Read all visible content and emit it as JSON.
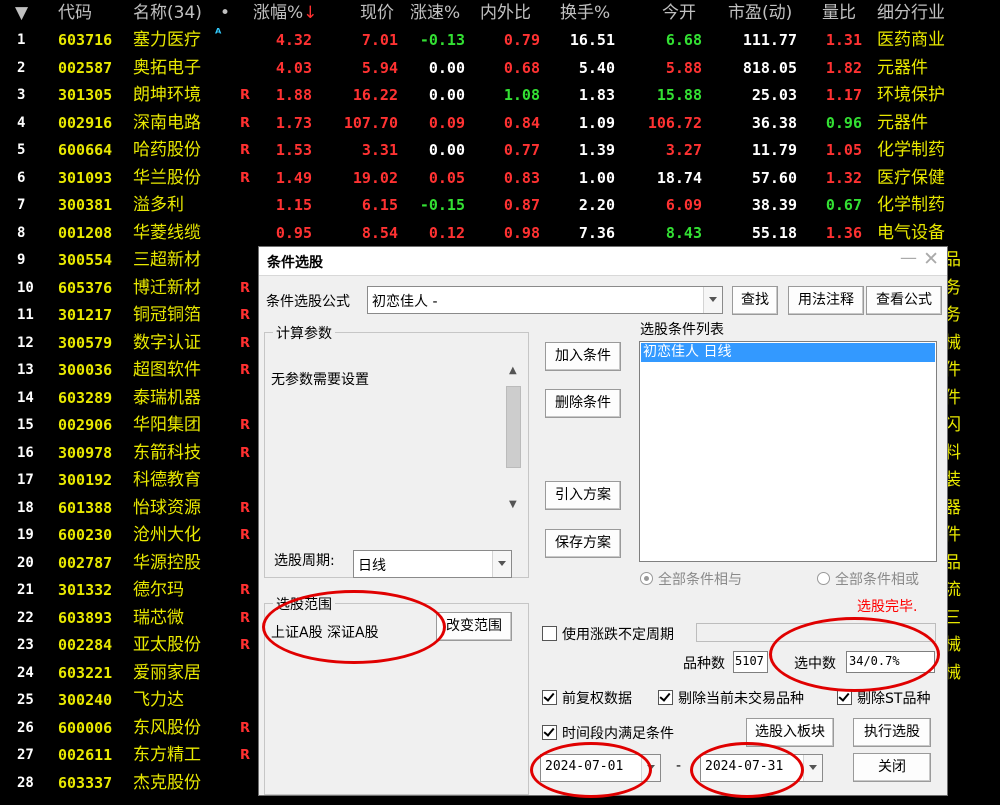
{
  "table": {
    "headers": {
      "sort": "▼",
      "code": "代码",
      "name": "名称(34)",
      "dot": "•",
      "pct": "涨幅%",
      "pct_mark": "↓",
      "price": "现价",
      "speed": "涨速%",
      "io": "内外比",
      "turnover": "换手%",
      "open": "今开",
      "pe": "市盈(动)",
      "vr": "量比",
      "industry": "细分行业"
    },
    "rows": [
      {
        "idx": "1",
        "code": "603716",
        "name": "塞力医疗",
        "flag": "ᴬ",
        "pct": "4.32",
        "price": "7.01",
        "speed": "-0.13",
        "io": "0.79",
        "turnover": "16.51",
        "open": "6.68",
        "pe": "111.77",
        "vr": "1.31",
        "industry": "医药商业"
      },
      {
        "idx": "2",
        "code": "002587",
        "name": "奥拓电子",
        "flag": "",
        "pct": "4.03",
        "price": "5.94",
        "speed": "0.00",
        "io": "0.68",
        "turnover": "5.40",
        "open": "5.88",
        "pe": "818.05",
        "vr": "1.82",
        "industry": "元器件"
      },
      {
        "idx": "3",
        "code": "301305",
        "name": "朗坤环境",
        "flag": "R",
        "pct": "1.88",
        "price": "16.22",
        "speed": "0.00",
        "io": "1.08",
        "turnover": "1.83",
        "open": "15.88",
        "pe": "25.03",
        "vr": "1.17",
        "industry": "环境保护"
      },
      {
        "idx": "4",
        "code": "002916",
        "name": "深南电路",
        "flag": "R",
        "pct": "1.73",
        "price": "107.70",
        "speed": "0.09",
        "io": "0.84",
        "turnover": "1.09",
        "open": "106.72",
        "pe": "36.38",
        "vr": "0.96",
        "industry": "元器件"
      },
      {
        "idx": "5",
        "code": "600664",
        "name": "哈药股份",
        "flag": "R",
        "pct": "1.53",
        "price": "3.31",
        "speed": "0.00",
        "io": "0.77",
        "turnover": "1.39",
        "open": "3.27",
        "pe": "11.79",
        "vr": "1.05",
        "industry": "化学制药"
      },
      {
        "idx": "6",
        "code": "301093",
        "name": "华兰股份",
        "flag": "R",
        "pct": "1.49",
        "price": "19.02",
        "speed": "0.05",
        "io": "0.83",
        "turnover": "1.00",
        "open": "18.74",
        "pe": "57.60",
        "vr": "1.32",
        "industry": "医疗保健"
      },
      {
        "idx": "7",
        "code": "300381",
        "name": "溢多利",
        "flag": "",
        "pct": "1.15",
        "price": "6.15",
        "speed": "-0.15",
        "io": "0.87",
        "turnover": "2.20",
        "open": "6.09",
        "pe": "38.39",
        "vr": "0.67",
        "industry": "化学制药"
      },
      {
        "idx": "8",
        "code": "001208",
        "name": "华菱线缆",
        "flag": "",
        "pct": "0.95",
        "price": "8.54",
        "speed": "0.12",
        "io": "0.98",
        "turnover": "7.36",
        "open": "8.43",
        "pe": "55.18",
        "vr": "1.36",
        "industry": "电气设备"
      },
      {
        "idx": "9",
        "code": "300554",
        "name": "三超新材",
        "flag": ""
      },
      {
        "idx": "10",
        "code": "605376",
        "name": "博迁新材",
        "flag": "R"
      },
      {
        "idx": "11",
        "code": "301217",
        "name": "铜冠铜箔",
        "flag": "R"
      },
      {
        "idx": "12",
        "code": "300579",
        "name": "数字认证",
        "flag": "R"
      },
      {
        "idx": "13",
        "code": "300036",
        "name": "超图软件",
        "flag": "R"
      },
      {
        "idx": "14",
        "code": "603289",
        "name": "泰瑞机器",
        "flag": ""
      },
      {
        "idx": "15",
        "code": "002906",
        "name": "华阳集团",
        "flag": "R"
      },
      {
        "idx": "16",
        "code": "300978",
        "name": "东箭科技",
        "flag": "R"
      },
      {
        "idx": "17",
        "code": "300192",
        "name": "科德教育",
        "flag": ""
      },
      {
        "idx": "18",
        "code": "601388",
        "name": "怡球资源",
        "flag": "R"
      },
      {
        "idx": "19",
        "code": "600230",
        "name": "沧州大化",
        "flag": "R"
      },
      {
        "idx": "20",
        "code": "002787",
        "name": "华源控股",
        "flag": ""
      },
      {
        "idx": "21",
        "code": "301332",
        "name": "德尔玛",
        "flag": "R"
      },
      {
        "idx": "22",
        "code": "603893",
        "name": "瑞芯微",
        "flag": "R"
      },
      {
        "idx": "23",
        "code": "002284",
        "name": "亚太股份",
        "flag": "R"
      },
      {
        "idx": "24",
        "code": "603221",
        "name": "爱丽家居",
        "flag": ""
      },
      {
        "idx": "25",
        "code": "300240",
        "name": "飞力达",
        "flag": ""
      },
      {
        "idx": "26",
        "code": "600006",
        "name": "东风股份",
        "flag": "R"
      },
      {
        "idx": "27",
        "code": "002611",
        "name": "东方精工",
        "flag": "R"
      },
      {
        "idx": "28",
        "code": "603337",
        "name": "杰克股份",
        "flag": ""
      }
    ],
    "colors": {
      "up": "#ff3232",
      "down": "#33e033",
      "flat": "#ffffff",
      "name": "#e8e800"
    }
  },
  "dialog": {
    "title": "条件选股",
    "formula_label": "条件选股公式",
    "formula_value": "初恋佳人 -",
    "btn_find": "查找",
    "btn_usage": "用法注释",
    "btn_view": "查看公式",
    "params_group": "计算参数",
    "params_text": "无参数需要设置",
    "period_label": "选股周期:",
    "period_value": "日线",
    "scope_group": "选股范围",
    "scope_value": "上证A股 深证A股",
    "btn_change_scope": "改变范围",
    "btn_add": "加入条件",
    "btn_delete": "删除条件",
    "btn_import": "引入方案",
    "btn_save": "保存方案",
    "list_label": "选股条件列表",
    "list_items": [
      "初恋佳人 日线"
    ],
    "radio_and": "全部条件相与",
    "radio_or": "全部条件相或",
    "status": "选股完毕.",
    "chk_undefined_period": "使用涨跌不定周期",
    "count_label": "品种数",
    "count_value": "5107",
    "selected_label": "选中数",
    "selected_value": "34/0.7%",
    "chk_adjust": "前复权数据",
    "chk_exclude_untraded": "剔除当前未交易品种",
    "chk_exclude_st": "剔除ST品种",
    "chk_time_range": "时间段内满足条件",
    "btn_to_block": "选股入板块",
    "btn_execute": "执行选股",
    "date_from": "2024-07-01",
    "date_sep": "-",
    "date_to": "2024-07-31",
    "btn_close": "关闭"
  },
  "right_edge_glyphs": [
    "品",
    "务",
    "务",
    "械",
    "件",
    "件",
    "闪",
    "料",
    "装",
    "器",
    "件",
    "品",
    "流",
    "三",
    "械",
    "械"
  ]
}
